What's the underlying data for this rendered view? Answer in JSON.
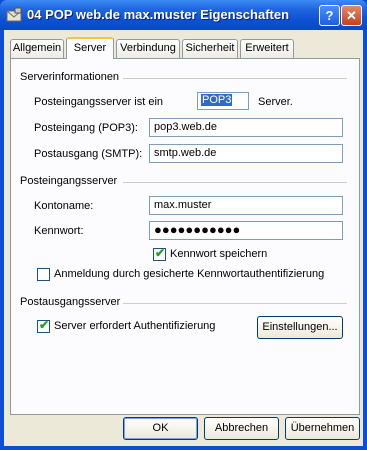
{
  "window": {
    "title": "04 POP web.de max.muster Eigenschaften",
    "help_label": "?",
    "close_label": "✕"
  },
  "tabs": [
    {
      "label": "Allgemein"
    },
    {
      "label": "Server",
      "selected": true
    },
    {
      "label": "Verbindung"
    },
    {
      "label": "Sicherheit"
    },
    {
      "label": "Erweitert"
    }
  ],
  "serverinfo": {
    "heading": "Serverinformationen",
    "incoming_type_label": "Posteingangsserver ist ein",
    "incoming_type_value": "POP3",
    "incoming_type_suffix": "Server.",
    "pop3_label": "Posteingang (POP3):",
    "pop3_value": "pop3.web.de",
    "smtp_label": "Postausgang (SMTP):",
    "smtp_value": "smtp.web.de"
  },
  "incoming": {
    "heading": "Posteingangsserver",
    "account_label": "Kontoname:",
    "account_value": "max.muster",
    "password_label": "Kennwort:",
    "password_value": "●●●●●●●●●●●",
    "save_password_label": "Kennwort speichern",
    "save_password_checked": true,
    "spa_label": "Anmeldung durch gesicherte Kennwortauthentifizierung",
    "spa_checked": false
  },
  "outgoing": {
    "heading": "Postausgangsserver",
    "auth_label": "Server erfordert Authentifizierung",
    "auth_checked": true,
    "settings_button": "Einstellungen..."
  },
  "footer": {
    "ok": "OK",
    "cancel": "Abbrechen",
    "apply": "Übernehmen"
  }
}
